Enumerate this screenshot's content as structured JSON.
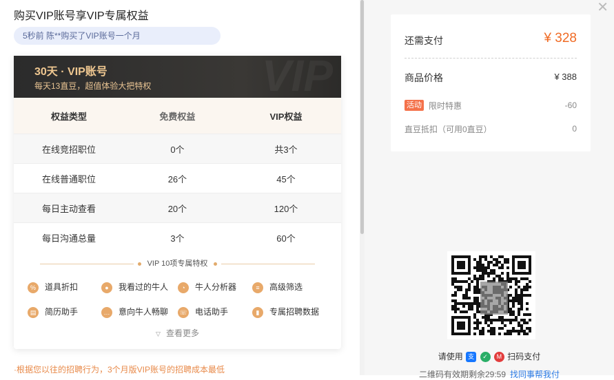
{
  "page": {
    "title": "购买VIP账号享VIP专属权益",
    "notice": "5秒前 陈**购买了VIP账号一个月"
  },
  "banner": {
    "title": "30天 · VIP账号",
    "subtitle": "每天13直豆，超值体验大把特权"
  },
  "table": {
    "headers": [
      "权益类型",
      "免费权益",
      "VIP权益"
    ],
    "rows": [
      [
        "在线竞招职位",
        "0个",
        "共3个"
      ],
      [
        "在线普通职位",
        "26个",
        "45个"
      ],
      [
        "每日主动查看",
        "20个",
        "120个"
      ],
      [
        "每日沟通总量",
        "3个",
        "60个"
      ]
    ]
  },
  "privileges": {
    "title": "VIP 10项专属特权",
    "items": [
      {
        "label": "道具折扣",
        "icon": "discount-icon"
      },
      {
        "label": "我看过的牛人",
        "icon": "person-icon"
      },
      {
        "label": "牛人分析器",
        "icon": "analysis-icon"
      },
      {
        "label": "高级筛选",
        "icon": "filter-icon"
      },
      {
        "label": "简历助手",
        "icon": "resume-icon"
      },
      {
        "label": "意向牛人畅聊",
        "icon": "chat-icon"
      },
      {
        "label": "电话助手",
        "icon": "phone-icon"
      },
      {
        "label": "专属招聘数据",
        "icon": "data-chart-icon"
      }
    ],
    "more_label": "查看更多"
  },
  "hint": "·根据您以往的招聘行为，3个月版VIP账号的招聘成本最低",
  "payment": {
    "need_label": "还需支付",
    "need_amount": "¥ 328",
    "price_label": "商品价格",
    "price_value": "¥ 388",
    "activity_tag": "活动",
    "activity_label": "限时特惠",
    "activity_value": "-60",
    "deduct_label": "直豆抵扣（可用0直豆）",
    "deduct_value": "0"
  },
  "scan": {
    "use_prefix": "请使用",
    "use_suffix": "扫码支付",
    "expire_text": "二维码有效期剩余29:59",
    "help_link": "找同事帮我付"
  },
  "colors": {
    "accent_orange": "#f06a23",
    "gold": "#f0c891",
    "banner_dark": "#2b2b2b",
    "link_blue": "#2c7be5"
  }
}
